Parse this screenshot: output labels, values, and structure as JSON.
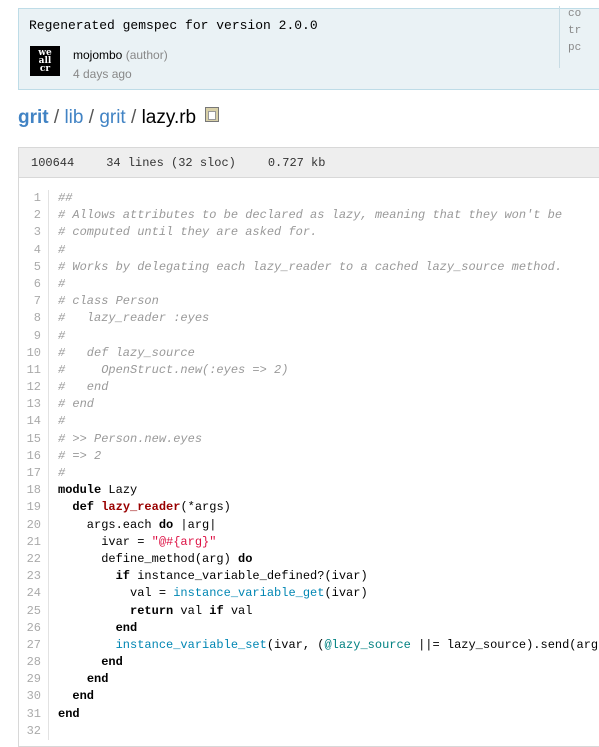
{
  "commit": {
    "message": "Regenerated gemspec for version 2.0.0",
    "author": "mojombo",
    "author_role": "(author)",
    "date": "4 days ago",
    "avatar_text": "we\nall\ncr",
    "side_lines": [
      "co",
      "tr",
      "pc"
    ]
  },
  "breadcrumb": {
    "root": "grit",
    "sep": "/",
    "lib": "lib",
    "grit": "grit",
    "file": "lazy.rb"
  },
  "file": {
    "mode": "100644",
    "lines": "34 lines (32 sloc)",
    "size": "0.727 kb"
  },
  "code_lines": [
    [
      [
        "c",
        "##"
      ]
    ],
    [
      [
        "c",
        "# Allows attributes to be declared as lazy, meaning that they won't be"
      ]
    ],
    [
      [
        "c",
        "# computed until they are asked for."
      ]
    ],
    [
      [
        "c",
        "#"
      ]
    ],
    [
      [
        "c",
        "# Works by delegating each lazy_reader to a cached lazy_source method."
      ]
    ],
    [
      [
        "c",
        "#"
      ]
    ],
    [
      [
        "c",
        "# class Person"
      ]
    ],
    [
      [
        "c",
        "#   lazy_reader :eyes"
      ]
    ],
    [
      [
        "c",
        "#"
      ]
    ],
    [
      [
        "c",
        "#   def lazy_source"
      ]
    ],
    [
      [
        "c",
        "#     OpenStruct.new(:eyes => 2)"
      ]
    ],
    [
      [
        "c",
        "#   end"
      ]
    ],
    [
      [
        "c",
        "# end"
      ]
    ],
    [
      [
        "c",
        "#"
      ]
    ],
    [
      [
        "c",
        "# >> Person.new.eyes"
      ]
    ],
    [
      [
        "c",
        "# => 2"
      ]
    ],
    [
      [
        "c",
        "#"
      ]
    ],
    [
      [
        "k",
        "module"
      ],
      [
        "t",
        " Lazy"
      ]
    ],
    [
      [
        "t",
        "  "
      ],
      [
        "k",
        "def"
      ],
      [
        "t",
        " "
      ],
      [
        "nf",
        "lazy_reader"
      ],
      [
        "t",
        "(*args)"
      ]
    ],
    [
      [
        "t",
        "    args.each "
      ],
      [
        "k",
        "do"
      ],
      [
        "t",
        " |arg|"
      ]
    ],
    [
      [
        "t",
        "      ivar = "
      ],
      [
        "s",
        "\"@#{arg}\""
      ]
    ],
    [
      [
        "t",
        "      define_method(arg) "
      ],
      [
        "k",
        "do"
      ]
    ],
    [
      [
        "t",
        "        "
      ],
      [
        "k",
        "if"
      ],
      [
        "t",
        " instance_variable_defined?(ivar)"
      ]
    ],
    [
      [
        "t",
        "          val = "
      ],
      [
        "b",
        "instance_variable_get"
      ],
      [
        "t",
        "(ivar)"
      ]
    ],
    [
      [
        "t",
        "          "
      ],
      [
        "k",
        "return"
      ],
      [
        "t",
        " val "
      ],
      [
        "k",
        "if"
      ],
      [
        "t",
        " val"
      ]
    ],
    [
      [
        "t",
        "        "
      ],
      [
        "k",
        "end"
      ]
    ],
    [
      [
        "t",
        "        "
      ],
      [
        "b",
        "instance_variable_set"
      ],
      [
        "t",
        "(ivar, ("
      ],
      [
        "iv",
        "@lazy_source"
      ],
      [
        "t",
        " ||= lazy_source).send(arg))"
      ]
    ],
    [
      [
        "t",
        "      "
      ],
      [
        "k",
        "end"
      ]
    ],
    [
      [
        "t",
        "    "
      ],
      [
        "k",
        "end"
      ]
    ],
    [
      [
        "t",
        "  "
      ],
      [
        "k",
        "end"
      ]
    ],
    [
      [
        "k",
        "end"
      ]
    ],
    [
      [
        "t",
        ""
      ]
    ]
  ]
}
